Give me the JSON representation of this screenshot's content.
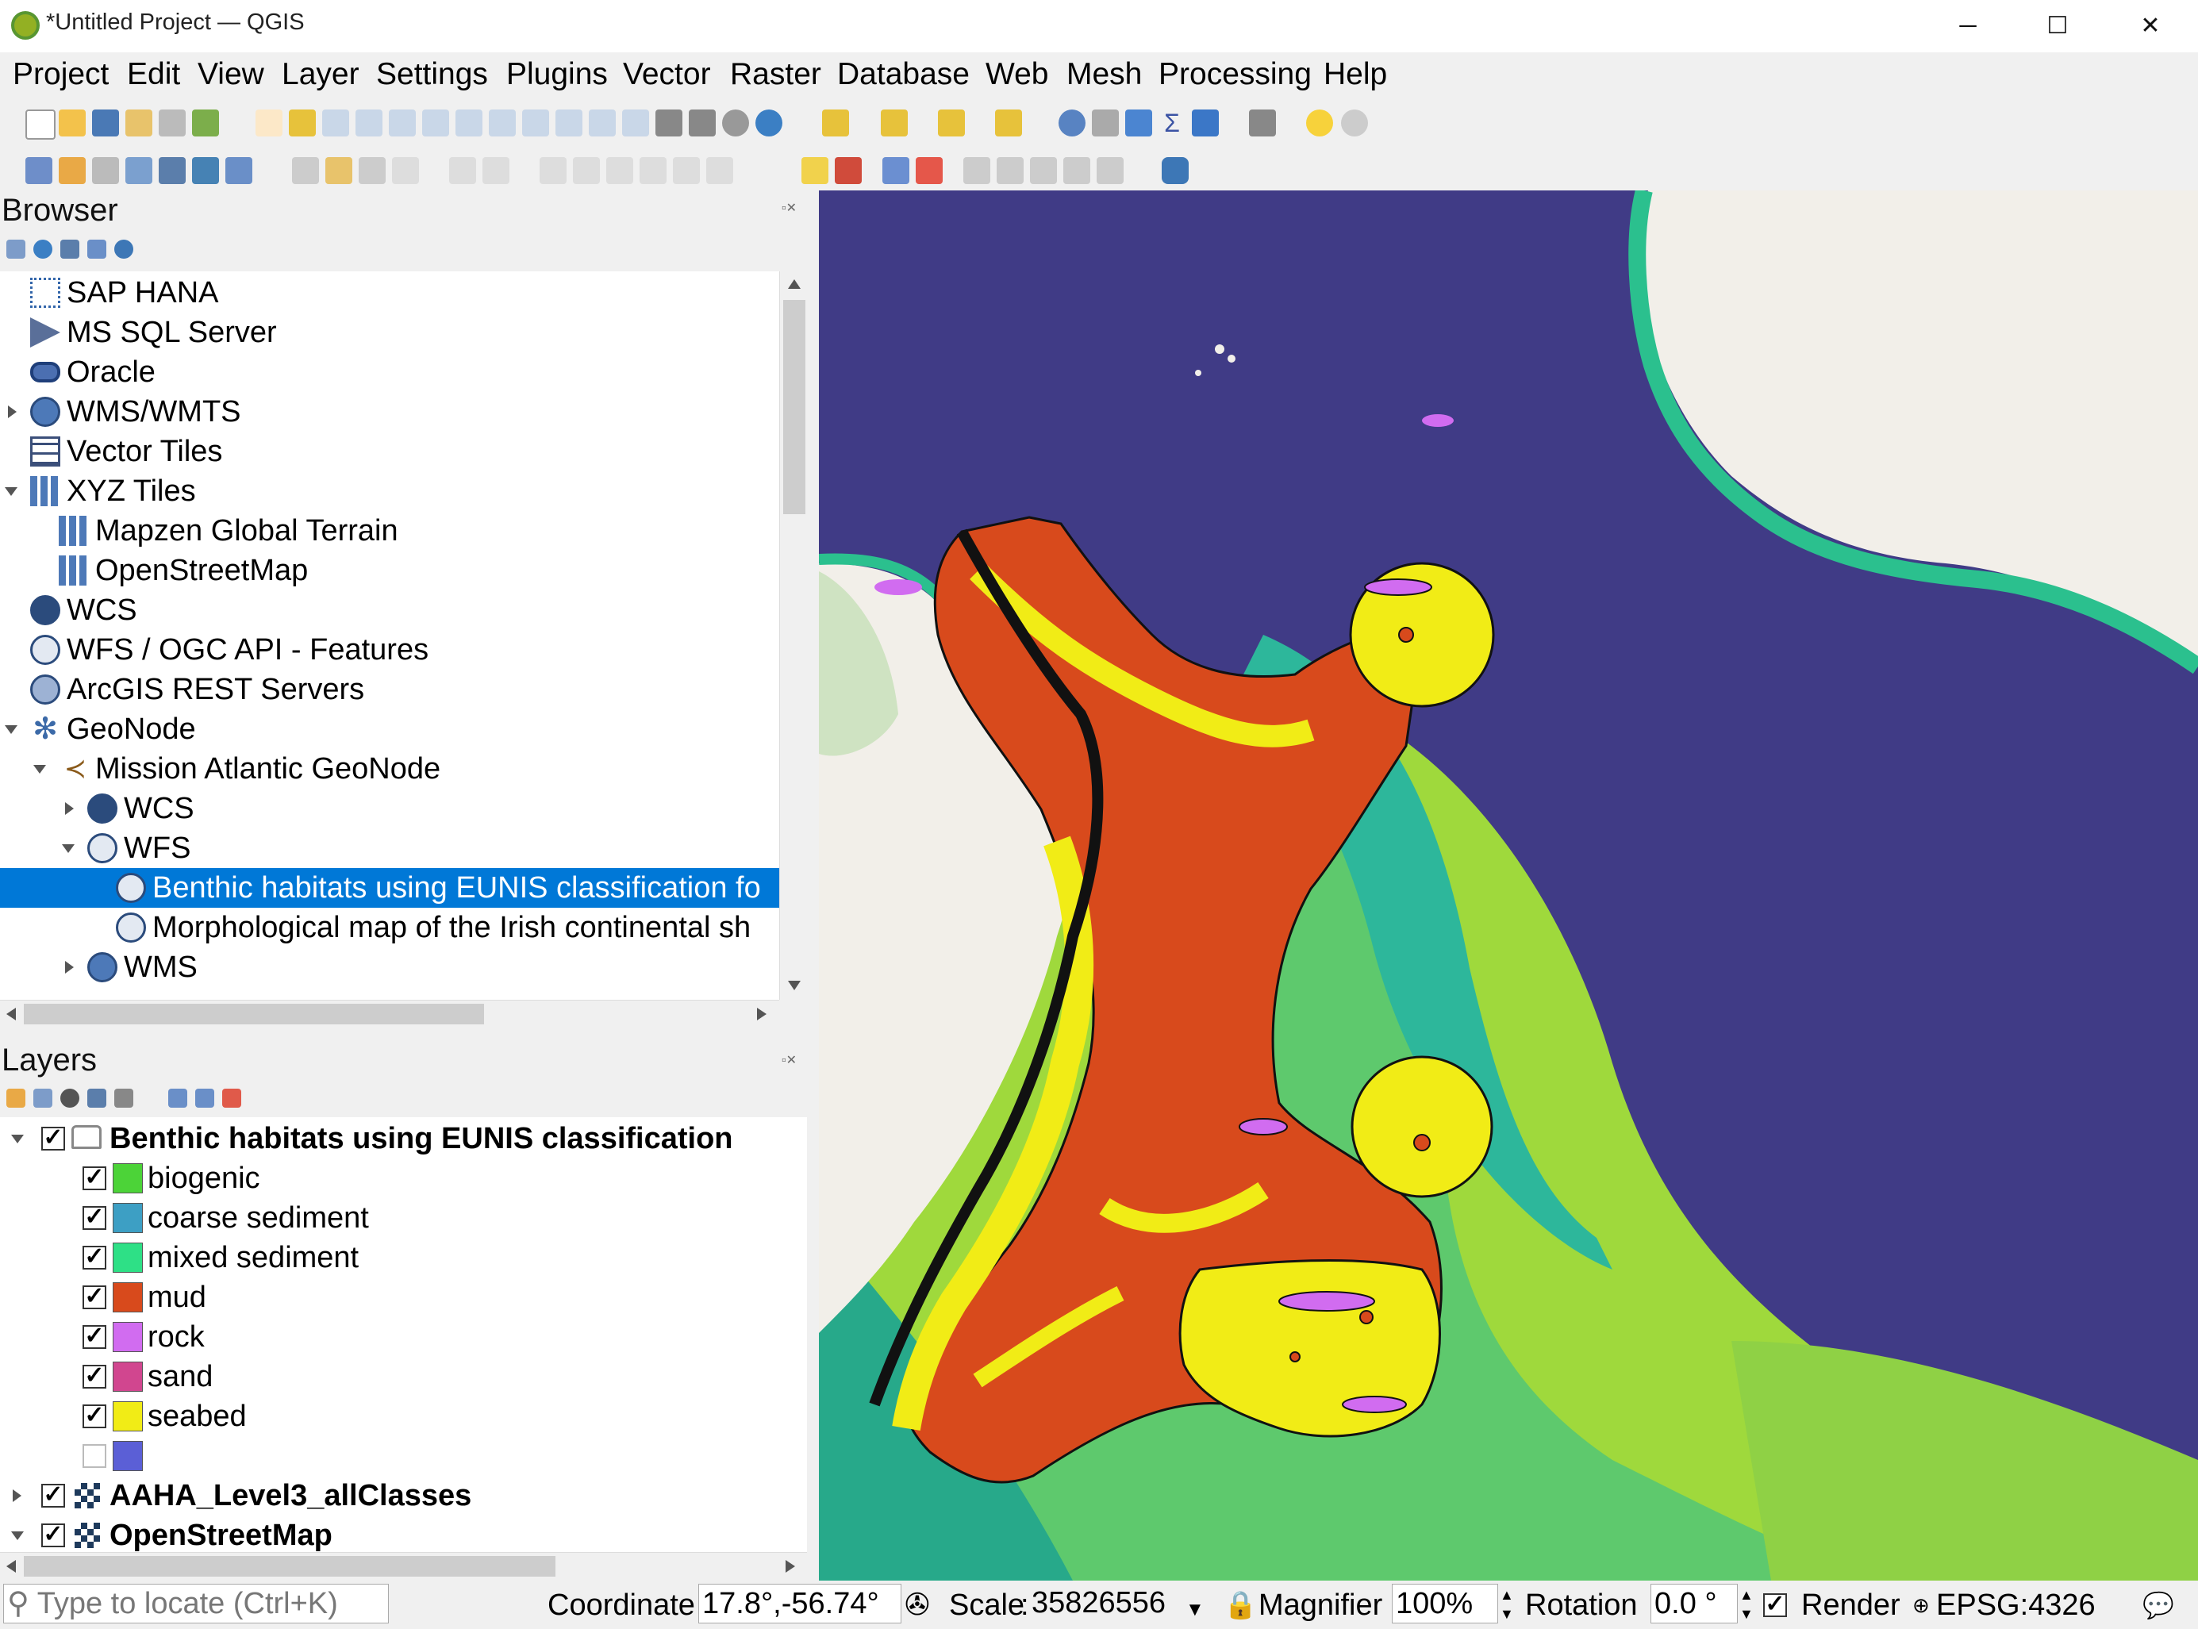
{
  "window": {
    "title": "*Untitled Project — QGIS",
    "controls": {
      "minimize": "─",
      "maximize": "☐",
      "close": "✕"
    }
  },
  "menubar": [
    "Project",
    "Edit",
    "View",
    "Layer",
    "Settings",
    "Plugins",
    "Vector",
    "Raster",
    "Database",
    "Web",
    "Mesh",
    "Processing",
    "Help"
  ],
  "browser": {
    "title": "Browser",
    "items": [
      {
        "label": "SAP HANA",
        "icon": "sap-hana-icon"
      },
      {
        "label": "MS SQL Server",
        "icon": "mssql-icon"
      },
      {
        "label": "Oracle",
        "icon": "oracle-icon"
      },
      {
        "label": "WMS/WMTS",
        "icon": "wms-icon"
      },
      {
        "label": "Vector Tiles",
        "icon": "vector-tiles-icon"
      },
      {
        "label": "XYZ Tiles",
        "icon": "xyz-tiles-icon"
      },
      {
        "label": "Mapzen Global Terrain",
        "icon": "xyz-tiles-icon"
      },
      {
        "label": "OpenStreetMap",
        "icon": "xyz-tiles-icon"
      },
      {
        "label": "WCS",
        "icon": "wcs-icon"
      },
      {
        "label": "WFS / OGC API - Features",
        "icon": "wfs-icon"
      },
      {
        "label": "ArcGIS REST Servers",
        "icon": "arcgis-icon"
      },
      {
        "label": "GeoNode",
        "icon": "geonode-icon"
      },
      {
        "label": "Mission Atlantic GeoNode",
        "icon": "geonode-connection-icon"
      },
      {
        "label": "WCS",
        "icon": "wcs-icon"
      },
      {
        "label": "WFS",
        "icon": "wfs-icon"
      },
      {
        "label": "Benthic habitats using EUNIS classification fo",
        "icon": "wfs-layer-icon"
      },
      {
        "label": "Morphological map of the Irish continental sh",
        "icon": "wfs-layer-icon"
      },
      {
        "label": "WMS",
        "icon": "wms-icon"
      }
    ]
  },
  "layers": {
    "title": "Layers",
    "group": "Benthic habitats using EUNIS classification",
    "classes": [
      {
        "label": "biogenic",
        "color": "#4cd338"
      },
      {
        "label": "coarse sediment",
        "color": "#3d9fc4"
      },
      {
        "label": "mixed sediment",
        "color": "#2ee086"
      },
      {
        "label": "mud",
        "color": "#d84a1c"
      },
      {
        "label": "rock",
        "color": "#d16cf0"
      },
      {
        "label": "sand",
        "color": "#d1468f"
      },
      {
        "label": "seabed",
        "color": "#f1ec16"
      },
      {
        "label": "",
        "color": "#5b5fd6"
      }
    ],
    "other": [
      "AAHA_Level3_allClasses",
      "OpenStreetMap"
    ]
  },
  "status": {
    "locate_placeholder": "Type to locate (Ctrl+K)",
    "coordinate_label": "Coordinate",
    "coordinate_value": "17.8°,-56.74°",
    "scale_label": "Scale",
    "scale_value": "35826556",
    "magnifier_label": "Magnifier",
    "magnifier_value": "100%",
    "rotation_label": "Rotation",
    "rotation_value": "0.0 °",
    "render_label": "Render",
    "crs": "EPSG:4326"
  },
  "colors": {
    "ocean_deep": "#403b86",
    "ocean_mid": "#2db79b",
    "ocean_shelf": "#9fd93c",
    "land": "#f2efe9",
    "selection": "#0078d7"
  }
}
